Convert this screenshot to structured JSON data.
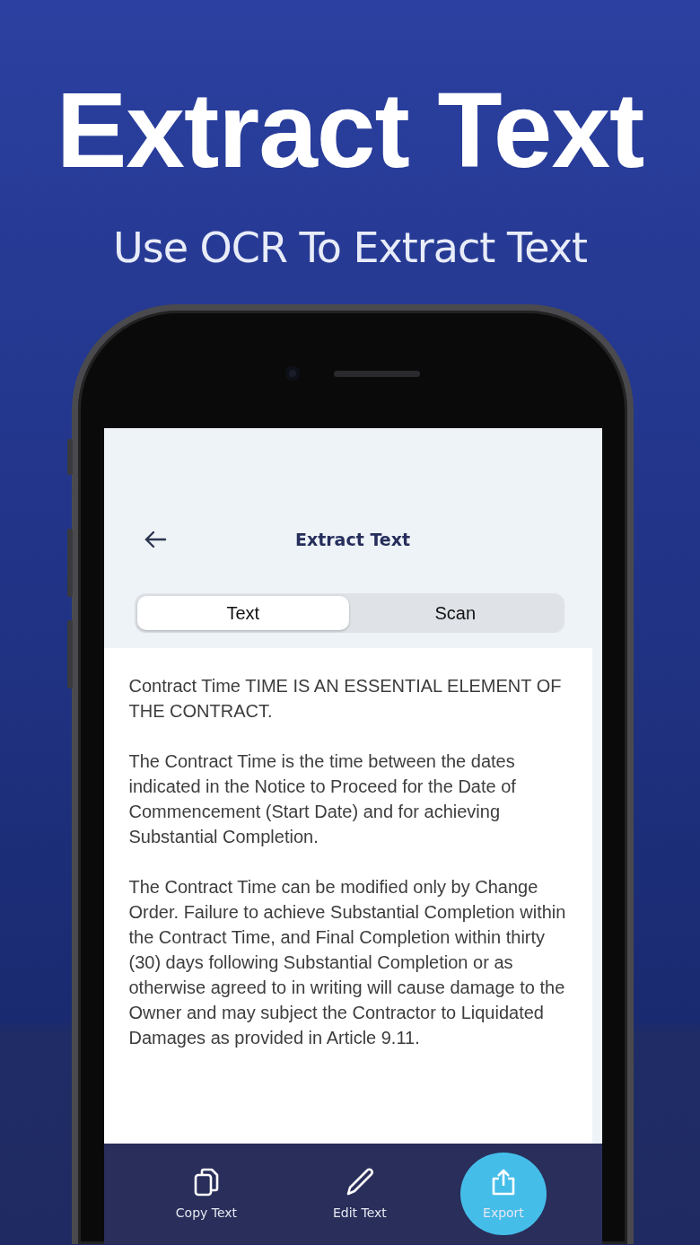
{
  "promo": {
    "title": "Extract Text",
    "subtitle": "Use OCR To Extract Text"
  },
  "app": {
    "header": {
      "title": "Extract Text"
    },
    "tabs": [
      {
        "label": "Text",
        "selected": true
      },
      {
        "label": "Scan",
        "selected": false
      }
    ],
    "paragraphs": [
      "Contract Time TIME IS AN ESSENTIAL ELEMENT OF THE CONTRACT.",
      "The Contract Time is the time between the dates indicated in the Notice to Proceed for the Date of Commencement (Start Date) and for achieving Substantial Completion.",
      "The Contract Time can be modified only by Change Order. Failure to achieve Substantial Completion within the Contract Time, and Final Completion within thirty (30) days following Substantial Completion or as otherwise agreed to in writing will cause damage to the Owner and may subject the Contractor to Liquidated Damages as provided in Article 9.11."
    ],
    "actions": [
      {
        "label": "Copy Text",
        "kind": "copy",
        "selected": false
      },
      {
        "label": "Edit Text",
        "kind": "edit",
        "selected": false
      },
      {
        "label": "Export",
        "kind": "export",
        "selected": true
      }
    ]
  }
}
